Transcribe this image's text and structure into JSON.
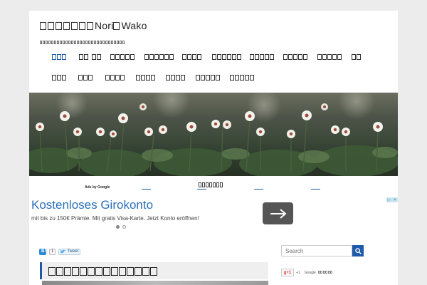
{
  "header": {
    "site_title_name": "Nori",
    "site_title_sep": "",
    "site_title_name2": "Wako",
    "site_description": ""
  },
  "nav": {
    "row1": [
      {
        "label": "",
        "active": true
      },
      {
        "label": ""
      },
      {
        "label": ""
      },
      {
        "label": ""
      },
      {
        "label": ""
      },
      {
        "label": ""
      },
      {
        "label": ""
      },
      {
        "label": ""
      },
      {
        "label": ""
      },
      {
        "label": ""
      }
    ],
    "row2": [
      {
        "label": ""
      },
      {
        "label": ""
      },
      {
        "label": ""
      },
      {
        "label": ""
      },
      {
        "label": ""
      },
      {
        "label": ""
      },
      {
        "label": ""
      }
    ]
  },
  "hero": {
    "caption": ""
  },
  "ads": {
    "ads_by": "Ads by Google",
    "headline": "Kostenloses Girokonto",
    "subtext": "mit bis zu 150€ Prämie. Mit gratis Visa-Karte. Jetzt Konto eröffnen!",
    "arrow_icon": "arrow-right-icon",
    "close_label": "✕"
  },
  "share": {
    "hatena_label": "B!",
    "hatena_count": "1",
    "tweet_label": "Tweet"
  },
  "post": {
    "title": ""
  },
  "sidebar": {
    "search_placeholder": "Search",
    "search_icon": "search-icon",
    "gplus_label": "g+1",
    "gplus_count": "+1",
    "gplus_brand": "Google"
  },
  "colors": {
    "accent": "#1e5aa8",
    "ad_headline": "#2a6fb8",
    "background": "#ececec"
  }
}
